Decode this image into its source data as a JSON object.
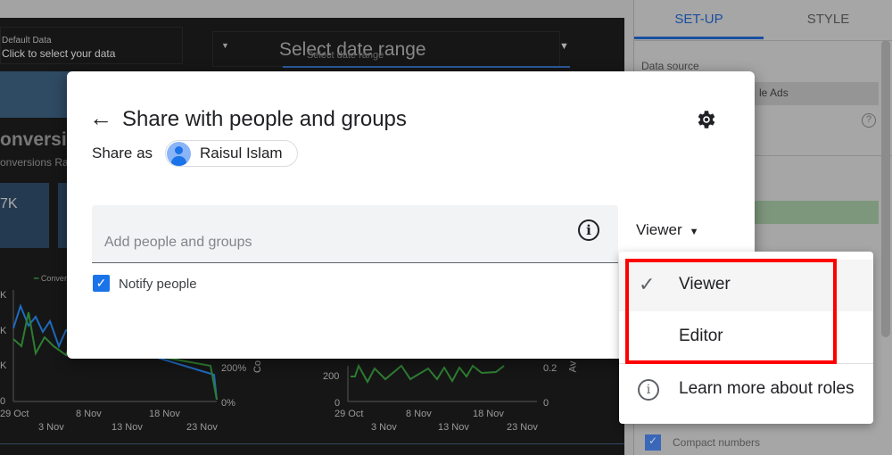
{
  "dashboard": {
    "data_control": {
      "label": "Default Data",
      "value": "Click to select your data"
    },
    "date_control": {
      "label": "Select date range",
      "sub_label": "Select date range"
    },
    "scorecard_title": "onversion",
    "scorecard_subtitle": "onversions Rat",
    "kpi_value": "7K",
    "chart1": {
      "legend": "Convers",
      "y_ticks": [
        "K",
        "K",
        "K",
        "0"
      ],
      "y2_ticks": [
        "200%",
        "0%"
      ],
      "y2_label": "Co",
      "x_ticks_top": [
        "29 Oct",
        "8 Nov",
        "18 Nov"
      ],
      "x_ticks_bottom": [
        "3 Nov",
        "13 Nov",
        "23 Nov"
      ]
    },
    "chart2": {
      "y_ticks": [
        "200",
        "0"
      ],
      "y2_ticks": [
        "0.2",
        "0"
      ],
      "y2_label": "Av",
      "x_ticks_top": [
        "29 Oct",
        "8 Nov",
        "18 Nov"
      ],
      "x_ticks_bottom": [
        "3 Nov",
        "13 Nov",
        "23 Nov"
      ]
    }
  },
  "side_panel": {
    "tabs": [
      {
        "label": "SET-UP",
        "active": true
      },
      {
        "label": "STYLE",
        "active": false
      }
    ],
    "data_source_label": "Data source",
    "data_source_value": "le Ads",
    "compact_numbers_label": "Compact numbers",
    "compact_numbers_checked": true,
    "accent": "#1a73e8"
  },
  "modal": {
    "title": "Share with people and groups",
    "share_as_label": "Share as",
    "user_name": "Raisul Islam",
    "input_placeholder": "Add people and groups",
    "role_selected": "Viewer",
    "notify_label": "Notify people",
    "notify_checked": true
  },
  "role_menu": {
    "items": [
      {
        "label": "Viewer",
        "checked": true
      },
      {
        "label": "Editor",
        "checked": false
      }
    ],
    "learn_more": "Learn more about roles",
    "highlight_color": "#ff0000"
  }
}
